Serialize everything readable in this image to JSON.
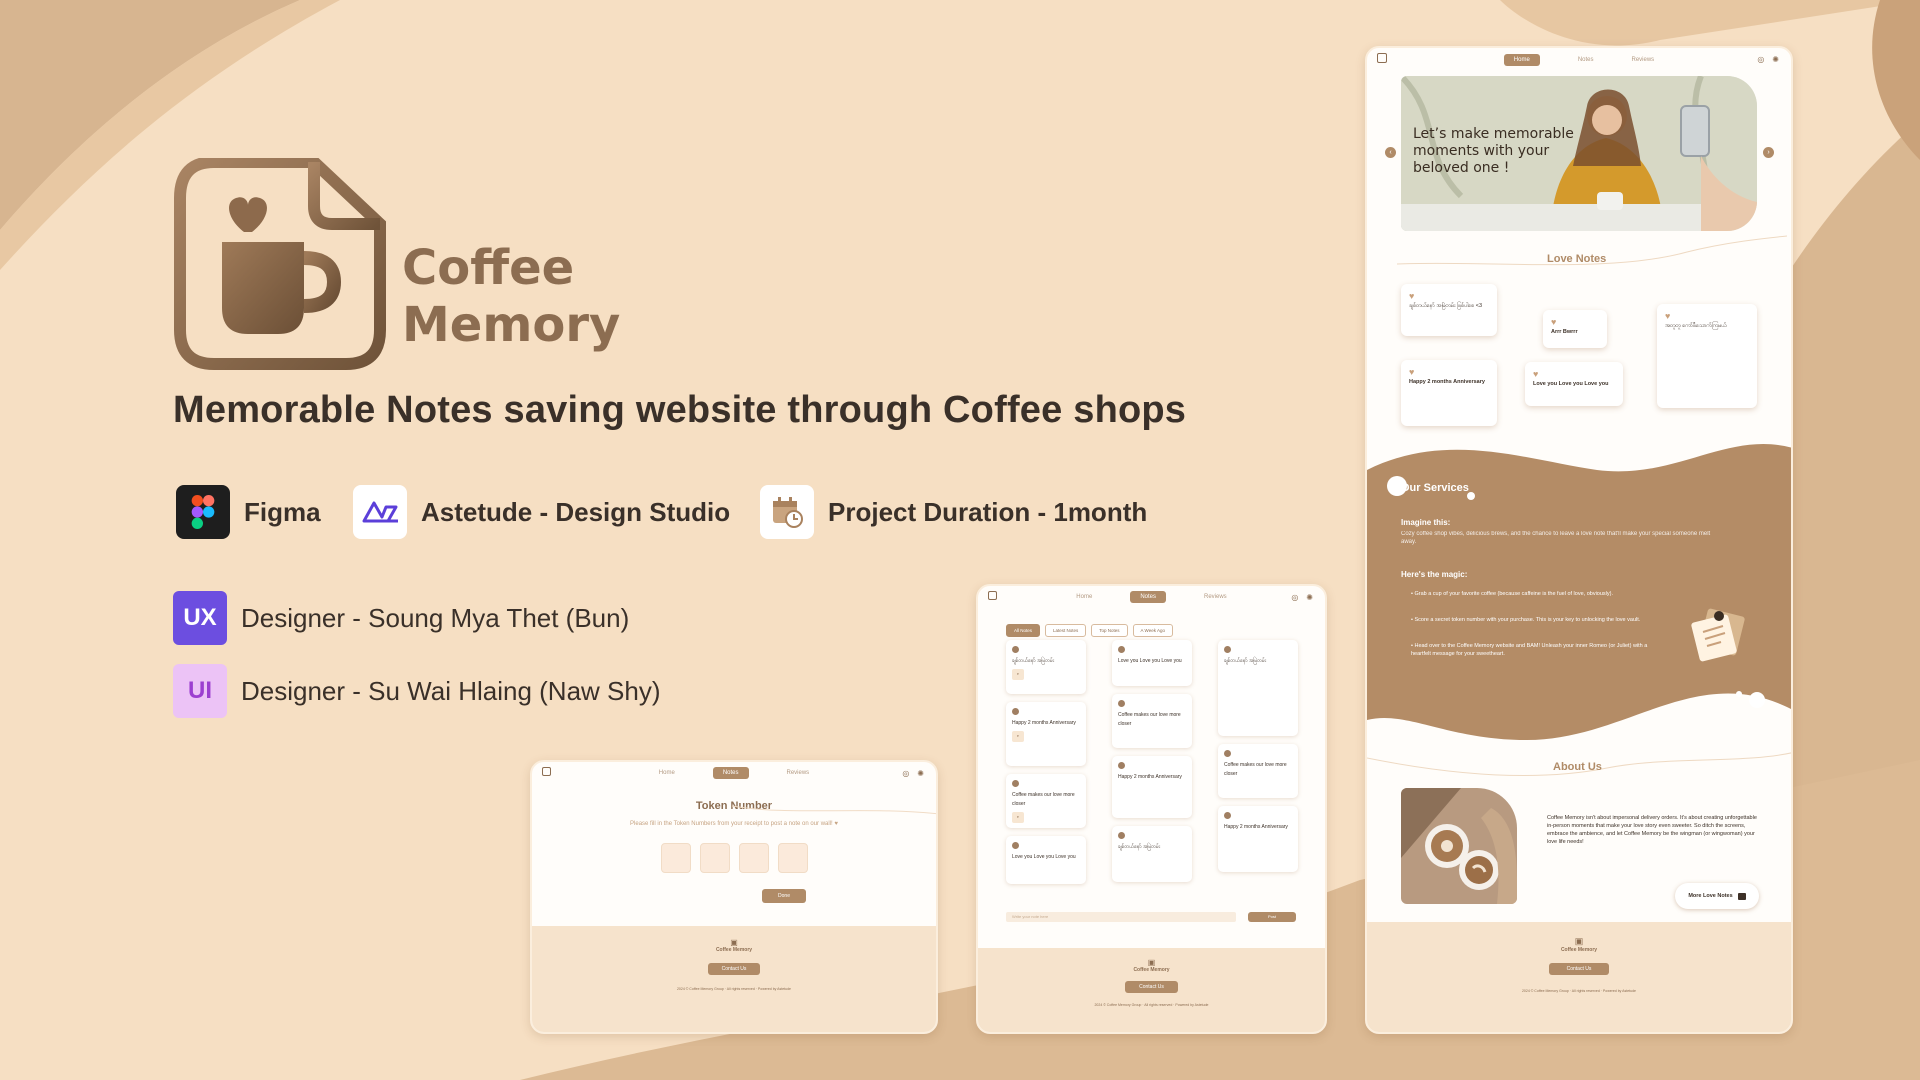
{
  "brand": {
    "line1": "Coffee",
    "line2": "Memory"
  },
  "headline": "Memorable Notes saving website through Coffee shops",
  "tools": [
    {
      "icon": "figma-icon",
      "label": "Figma"
    },
    {
      "icon": "astetude-icon",
      "label": "Astetude - Design Studio"
    },
    {
      "icon": "calendar-clock-icon",
      "label": "Project Duration - 1month"
    }
  ],
  "roles": [
    {
      "badge": "UX",
      "text": "Designer - Soung Mya Thet (Bun)",
      "color": "#6c4ee0"
    },
    {
      "badge": "UI",
      "text": "Designer - Su Wai Hlaing (Naw Shy)",
      "color": "#9c5bd6"
    }
  ],
  "colors": {
    "background": "#f6dfc3",
    "accent": "#b08b67",
    "brand_text": "#8c6d51",
    "dark_text": "#3a3029"
  },
  "nav": {
    "home": "Home",
    "notes": "Notes",
    "reviews": "Reviews"
  },
  "footer": {
    "brand": "Coffee Memory",
    "contact": "Contact Us",
    "copyright": "2024 © Coffee Memory Group",
    "rights": "All rights reserved",
    "powered": "Powered by Astetude"
  },
  "token_page": {
    "title": "Token Number",
    "subtitle": "Please fill in the Token Numbers from your receipt to post a note on our wall! ♥",
    "done": "Done"
  },
  "notes_page": {
    "filters": [
      "All Notes",
      "Latest Notes",
      "Top Notes",
      "A Week Ago"
    ],
    "post_placeholder": "Write your note here",
    "post_button": "Post",
    "cards": [
      "ချစ်တယ်နော် အမြဲတမ်း",
      "Happy 2 months Anniversary",
      "Coffee makes our love more closer",
      "Love you Love you Love you"
    ]
  },
  "home_page": {
    "hero": "Let’s make memorable moments with your beloved one !",
    "love_notes_title": "Love Notes",
    "love_notes": [
      "ချစ်တယ်နော် အမြဲတမ်း ဖြစ်ပါစေ <3",
      "Arrr Bwrrr",
      "Happy 2 months Anniversary",
      "Love you Love you Love you",
      "အတူတူ ကော်ဖီသောက်ကြမယ်"
    ],
    "services_title": "Our Services",
    "imagine_title": "Imagine this:",
    "imagine_text": "Cozy coffee shop vibes, delicious brews, and the chance to leave a love note that'll make your special someone melt away.",
    "magic_title": "Here's the magic:",
    "magic_items": [
      "Grab a cup of your favorite coffee (because caffeine is the fuel of love, obviously).",
      "Score a secret token number with your purchase. This is your key to unlocking the love vault.",
      "Head over to the Coffee Memory website and BAM! Unleash your inner Romeo (or Juliet) with a heartfelt message for your sweetheart."
    ],
    "about_title": "About Us",
    "about_text": "Coffee Memory isn't about impersonal delivery orders. It's about creating unforgettable in-person moments that make your love story even sweeter. So ditch the screens, embrace the ambience, and let Coffee Memory be the wingman (or wingwoman) your love life needs!",
    "more_button": "More Love Notes"
  }
}
